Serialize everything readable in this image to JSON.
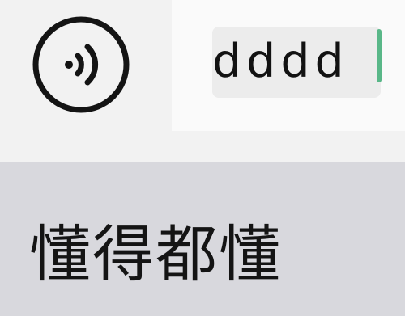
{
  "input": {
    "value": "dddd"
  },
  "voice_button": {
    "icon": "voice-input-icon"
  },
  "candidates": {
    "first": "懂得都懂"
  },
  "colors": {
    "caret": "#59b788",
    "candidate_bar": "#d8d8dd",
    "field_background": "#ececec"
  }
}
